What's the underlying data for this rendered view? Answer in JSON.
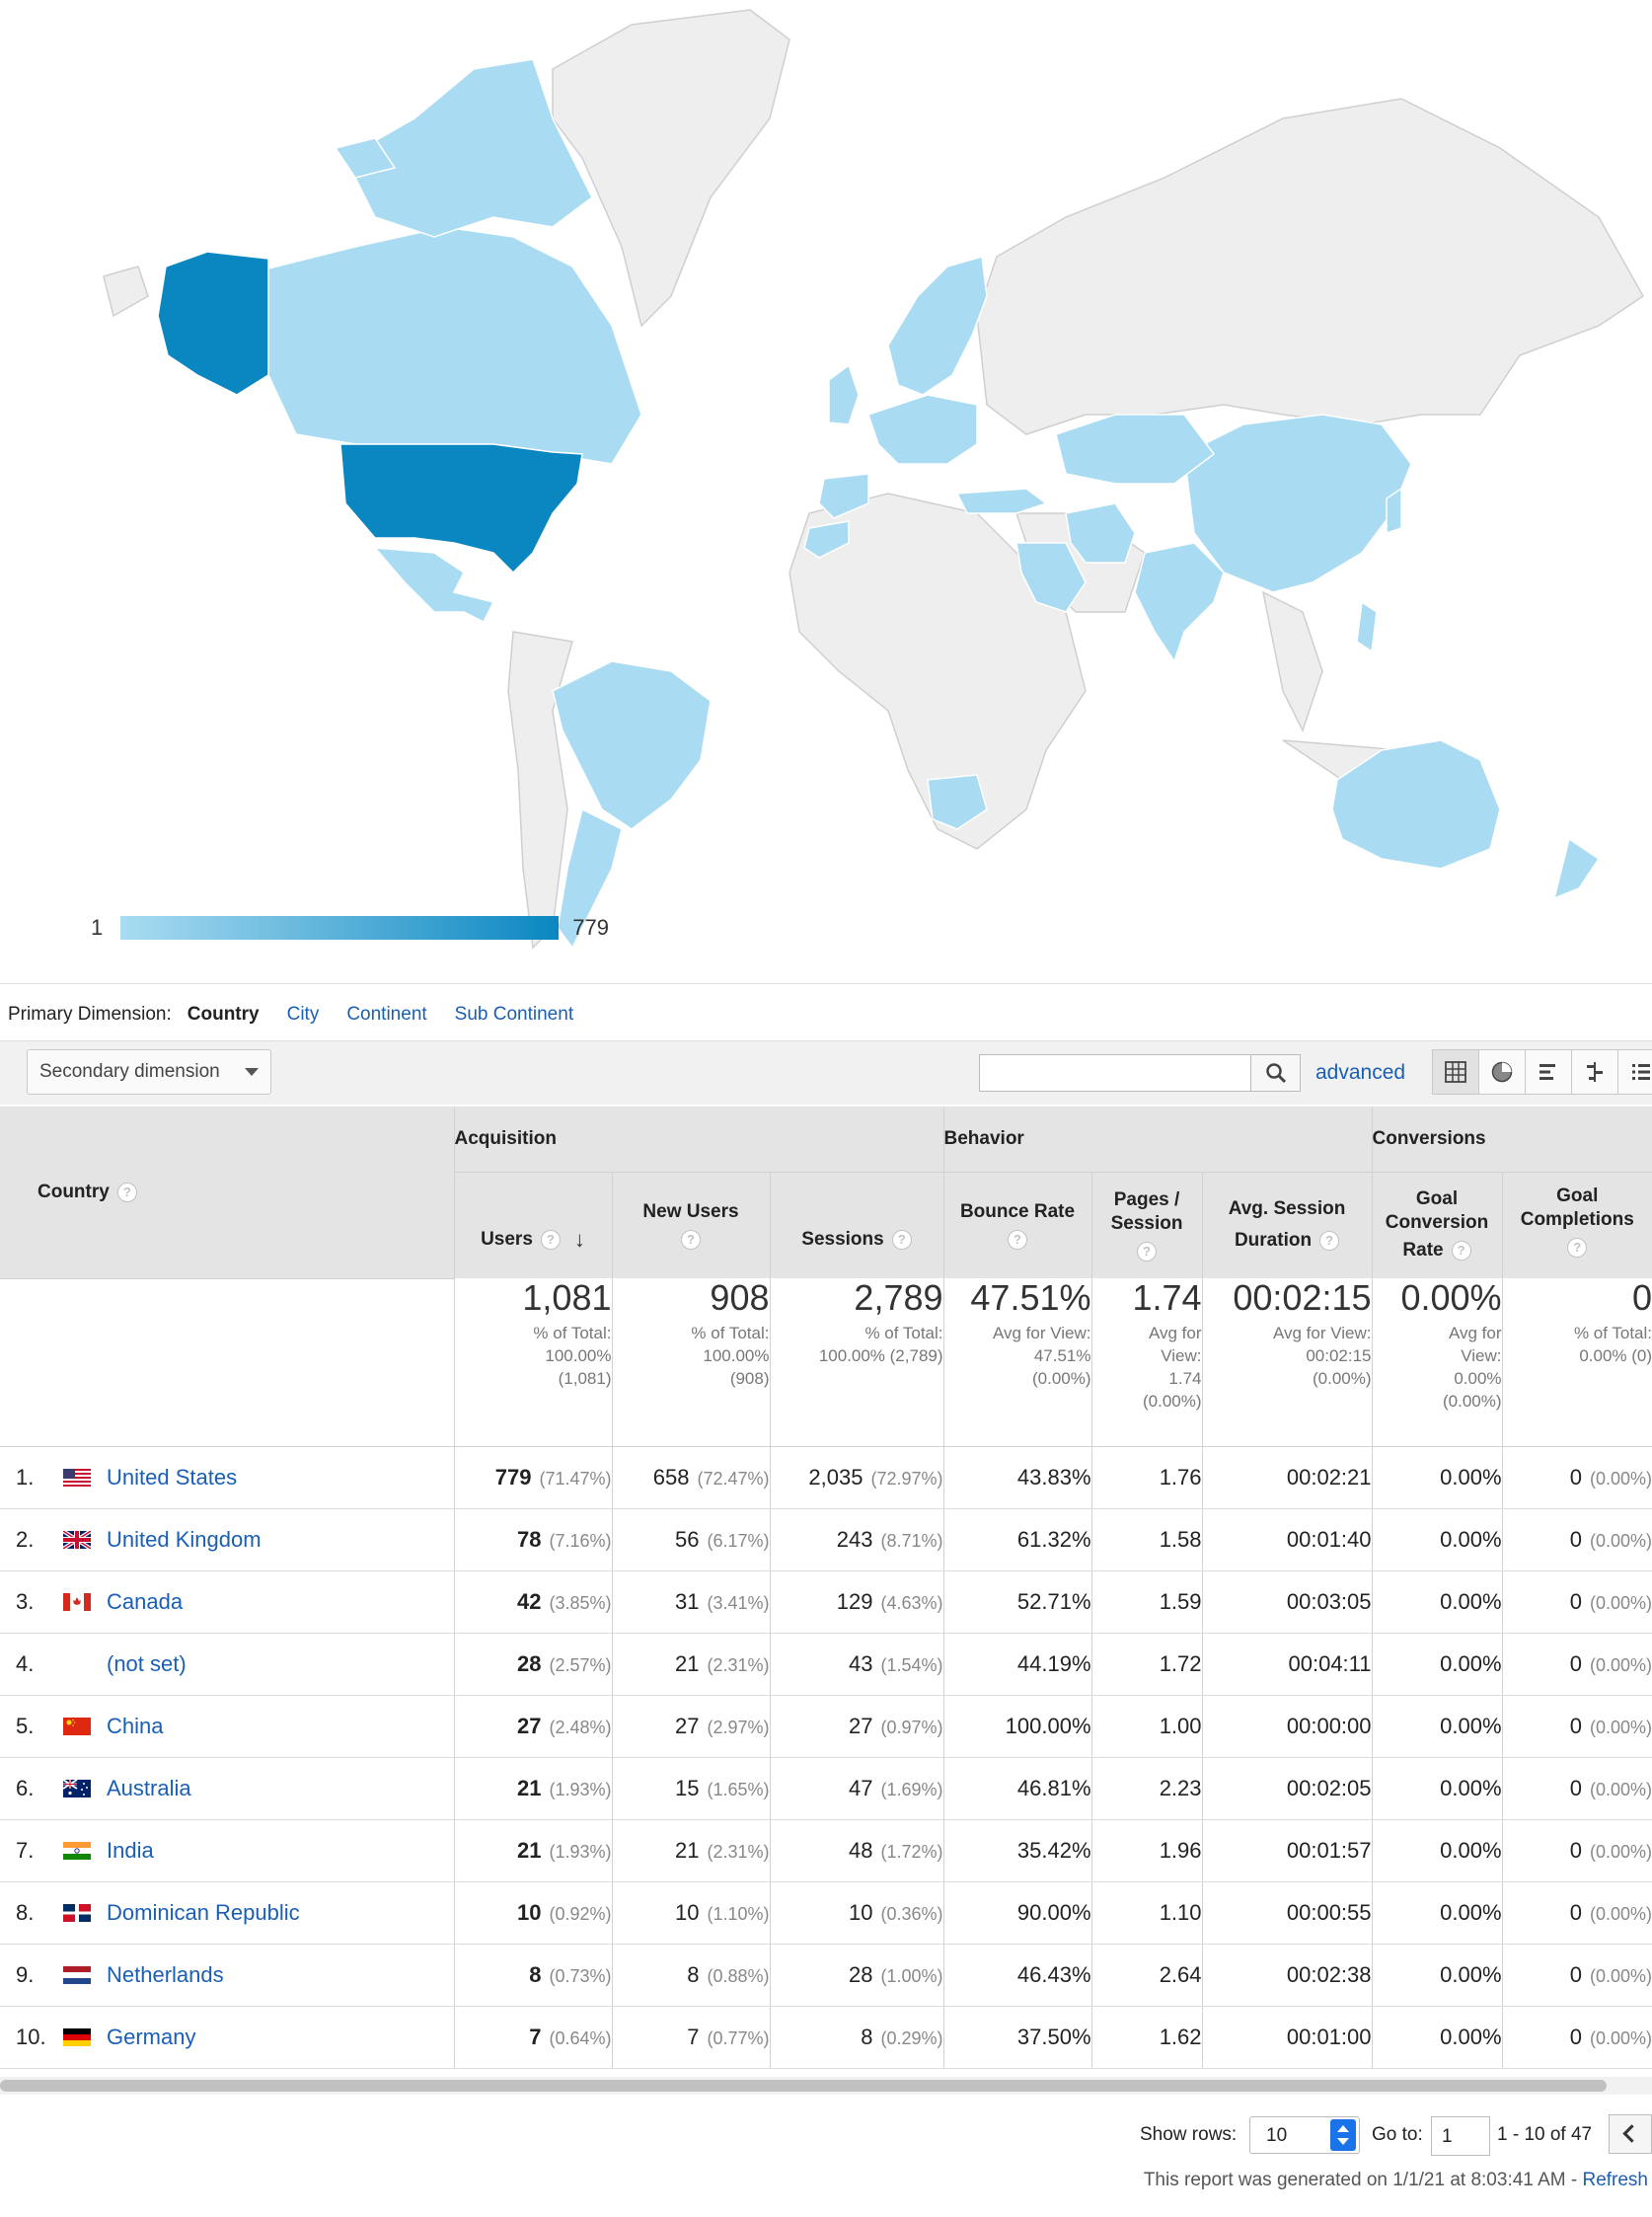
{
  "map": {
    "legend_min": "1",
    "legend_max": "779",
    "colors": {
      "low": "#a9dcf2",
      "high": "#0a87c1",
      "none": "#eeeeee"
    },
    "shaded_countries": [
      "United States",
      "Canada",
      "Mexico",
      "Brazil",
      "Argentina",
      "Australia",
      "China",
      "India",
      "Japan",
      "Kazakhstan",
      "Iran",
      "Saudi Arabia",
      "Turkey",
      "Spain",
      "France",
      "Germany",
      "Netherlands",
      "United Kingdom",
      "Norway",
      "Sweden",
      "Finland",
      "Poland",
      "Italy",
      "South Africa",
      "New Zealand",
      "Philippines",
      "Morocco"
    ]
  },
  "dimensions": {
    "label": "Primary Dimension:",
    "current": "Country",
    "options": [
      "City",
      "Continent",
      "Sub Continent"
    ]
  },
  "toolbar": {
    "secondary_dimension": "Secondary dimension",
    "search_placeholder": "",
    "advanced": "advanced",
    "views": [
      "table-view-icon",
      "pie-view-icon",
      "bar-view-icon",
      "comparison-view-icon",
      "pivot-view-icon"
    ]
  },
  "table": {
    "groups": {
      "country": "Country",
      "acquisition": "Acquisition",
      "behavior": "Behavior",
      "conversions": "Conversions"
    },
    "columns": {
      "users": "Users",
      "new_users": "New Users",
      "sessions": "Sessions",
      "bounce_rate": "Bounce Rate",
      "pages_1": "Pages /",
      "pages_2": "Session",
      "duration_1": "Avg. Session",
      "duration_2": "Duration",
      "goal_conv_1": "Goal",
      "goal_conv_2": "Conversion",
      "goal_conv_3": "Rate",
      "goal_comp_1": "Goal",
      "goal_comp_2": "Completions"
    },
    "totals": {
      "users": {
        "value": "1,081",
        "l1": "% of Total:",
        "l2": "100.00%",
        "l3": "(1,081)"
      },
      "new_users": {
        "value": "908",
        "l1": "% of Total:",
        "l2": "100.00%",
        "l3": "(908)"
      },
      "sessions": {
        "value": "2,789",
        "l1": "% of Total:",
        "l2": "100.00% (2,789)",
        "l3": ""
      },
      "bounce_rate": {
        "value": "47.51%",
        "l1": "Avg for View:",
        "l2": "47.51%",
        "l3": "(0.00%)"
      },
      "pages": {
        "value": "1.74",
        "l1": "Avg for",
        "l2": "View:",
        "l3": "1.74",
        "l4": "(0.00%)"
      },
      "duration": {
        "value": "00:02:15",
        "l1": "Avg for View:",
        "l2": "00:02:15",
        "l3": "(0.00%)"
      },
      "goal_conv": {
        "value": "0.00%",
        "l1": "Avg for",
        "l2": "View:",
        "l3": "0.00%",
        "l4": "(0.00%)"
      },
      "goal_comp": {
        "value": "0",
        "l1": "% of Total:",
        "l2": "0.00% (0)"
      }
    },
    "rows": [
      {
        "n": "1.",
        "country": "United States",
        "users": "779",
        "users_pct": "(71.47%)",
        "new_users": "658",
        "new_users_pct": "(72.47%)",
        "sessions": "2,035",
        "sessions_pct": "(72.97%)",
        "bounce": "43.83%",
        "pages": "1.76",
        "duration": "00:02:21",
        "goal_conv": "0.00%",
        "goal_comp": "0",
        "goal_comp_pct": "(0.00%)"
      },
      {
        "n": "2.",
        "country": "United Kingdom",
        "users": "78",
        "users_pct": "(7.16%)",
        "new_users": "56",
        "new_users_pct": "(6.17%)",
        "sessions": "243",
        "sessions_pct": "(8.71%)",
        "bounce": "61.32%",
        "pages": "1.58",
        "duration": "00:01:40",
        "goal_conv": "0.00%",
        "goal_comp": "0",
        "goal_comp_pct": "(0.00%)"
      },
      {
        "n": "3.",
        "country": "Canada",
        "users": "42",
        "users_pct": "(3.85%)",
        "new_users": "31",
        "new_users_pct": "(3.41%)",
        "sessions": "129",
        "sessions_pct": "(4.63%)",
        "bounce": "52.71%",
        "pages": "1.59",
        "duration": "00:03:05",
        "goal_conv": "0.00%",
        "goal_comp": "0",
        "goal_comp_pct": "(0.00%)"
      },
      {
        "n": "4.",
        "country": "(not set)",
        "users": "28",
        "users_pct": "(2.57%)",
        "new_users": "21",
        "new_users_pct": "(2.31%)",
        "sessions": "43",
        "sessions_pct": "(1.54%)",
        "bounce": "44.19%",
        "pages": "1.72",
        "duration": "00:04:11",
        "goal_conv": "0.00%",
        "goal_comp": "0",
        "goal_comp_pct": "(0.00%)"
      },
      {
        "n": "5.",
        "country": "China",
        "users": "27",
        "users_pct": "(2.48%)",
        "new_users": "27",
        "new_users_pct": "(2.97%)",
        "sessions": "27",
        "sessions_pct": "(0.97%)",
        "bounce": "100.00%",
        "pages": "1.00",
        "duration": "00:00:00",
        "goal_conv": "0.00%",
        "goal_comp": "0",
        "goal_comp_pct": "(0.00%)"
      },
      {
        "n": "6.",
        "country": "Australia",
        "users": "21",
        "users_pct": "(1.93%)",
        "new_users": "15",
        "new_users_pct": "(1.65%)",
        "sessions": "47",
        "sessions_pct": "(1.69%)",
        "bounce": "46.81%",
        "pages": "2.23",
        "duration": "00:02:05",
        "goal_conv": "0.00%",
        "goal_comp": "0",
        "goal_comp_pct": "(0.00%)"
      },
      {
        "n": "7.",
        "country": "India",
        "users": "21",
        "users_pct": "(1.93%)",
        "new_users": "21",
        "new_users_pct": "(2.31%)",
        "sessions": "48",
        "sessions_pct": "(1.72%)",
        "bounce": "35.42%",
        "pages": "1.96",
        "duration": "00:01:57",
        "goal_conv": "0.00%",
        "goal_comp": "0",
        "goal_comp_pct": "(0.00%)"
      },
      {
        "n": "8.",
        "country": "Dominican Republic",
        "users": "10",
        "users_pct": "(0.92%)",
        "new_users": "10",
        "new_users_pct": "(1.10%)",
        "sessions": "10",
        "sessions_pct": "(0.36%)",
        "bounce": "90.00%",
        "pages": "1.10",
        "duration": "00:00:55",
        "goal_conv": "0.00%",
        "goal_comp": "0",
        "goal_comp_pct": "(0.00%)"
      },
      {
        "n": "9.",
        "country": "Netherlands",
        "users": "8",
        "users_pct": "(0.73%)",
        "new_users": "8",
        "new_users_pct": "(0.88%)",
        "sessions": "28",
        "sessions_pct": "(1.00%)",
        "bounce": "46.43%",
        "pages": "2.64",
        "duration": "00:02:38",
        "goal_conv": "0.00%",
        "goal_comp": "0",
        "goal_comp_pct": "(0.00%)"
      },
      {
        "n": "10.",
        "country": "Germany",
        "users": "7",
        "users_pct": "(0.64%)",
        "new_users": "7",
        "new_users_pct": "(0.77%)",
        "sessions": "8",
        "sessions_pct": "(0.29%)",
        "bounce": "37.50%",
        "pages": "1.62",
        "duration": "00:01:00",
        "goal_conv": "0.00%",
        "goal_comp": "0",
        "goal_comp_pct": "(0.00%)"
      }
    ]
  },
  "pager": {
    "show_rows_label": "Show rows:",
    "show_rows_value": "10",
    "goto_label": "Go to:",
    "goto_value": "1",
    "range": "1 - 10 of 47"
  },
  "footer": {
    "generated": "This report was generated on 1/1/21 at 8:03:41 AM -",
    "refresh": "Refresh"
  }
}
